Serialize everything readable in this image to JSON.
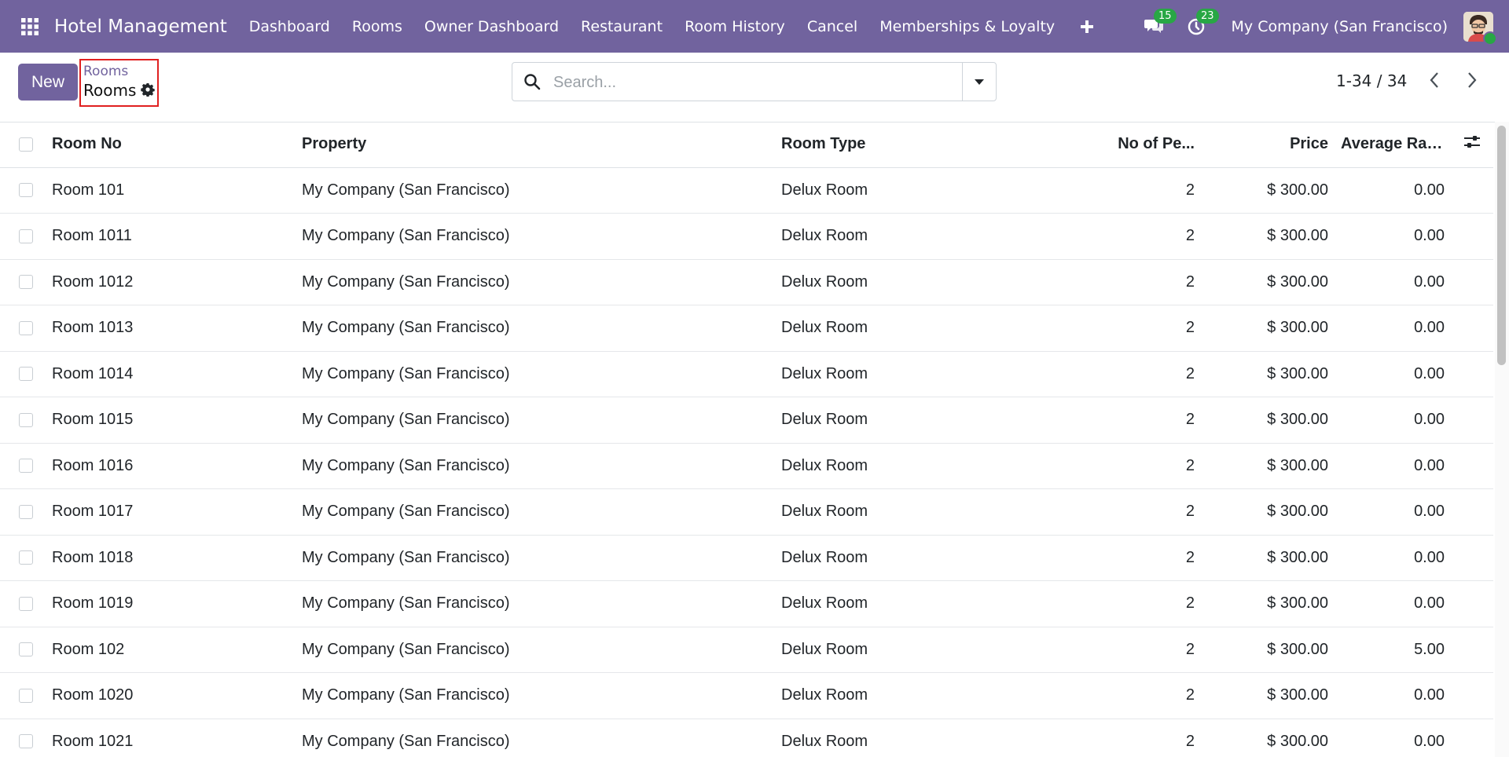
{
  "navbar": {
    "app_title": "Hotel Management",
    "menu": [
      "Dashboard",
      "Rooms",
      "Owner Dashboard",
      "Restaurant",
      "Room History",
      "Cancel",
      "Memberships & Loyalty"
    ],
    "messages_count": "15",
    "activities_count": "23",
    "company": "My Company (San Francisco)",
    "bg_color": "#71639e",
    "badge_color": "#28a745"
  },
  "control_panel": {
    "new_label": "New",
    "breadcrumb_parent": "Rooms",
    "breadcrumb_current": "Rooms",
    "search_placeholder": "Search...",
    "search_value": "",
    "pager": "1-34 / 34"
  },
  "table": {
    "headers": [
      "Room No",
      "Property",
      "Room Type",
      "No of Pe...",
      "Price",
      "Average Rat..."
    ],
    "rows": [
      {
        "room": "Room 101",
        "property": "My Company (San Francisco)",
        "type": "Delux Room",
        "persons": "2",
        "price": "$ 300.00",
        "rating": "0.00"
      },
      {
        "room": "Room 1011",
        "property": "My Company (San Francisco)",
        "type": "Delux Room",
        "persons": "2",
        "price": "$ 300.00",
        "rating": "0.00"
      },
      {
        "room": "Room 1012",
        "property": "My Company (San Francisco)",
        "type": "Delux Room",
        "persons": "2",
        "price": "$ 300.00",
        "rating": "0.00"
      },
      {
        "room": "Room 1013",
        "property": "My Company (San Francisco)",
        "type": "Delux Room",
        "persons": "2",
        "price": "$ 300.00",
        "rating": "0.00"
      },
      {
        "room": "Room 1014",
        "property": "My Company (San Francisco)",
        "type": "Delux Room",
        "persons": "2",
        "price": "$ 300.00",
        "rating": "0.00"
      },
      {
        "room": "Room 1015",
        "property": "My Company (San Francisco)",
        "type": "Delux Room",
        "persons": "2",
        "price": "$ 300.00",
        "rating": "0.00"
      },
      {
        "room": "Room 1016",
        "property": "My Company (San Francisco)",
        "type": "Delux Room",
        "persons": "2",
        "price": "$ 300.00",
        "rating": "0.00"
      },
      {
        "room": "Room 1017",
        "property": "My Company (San Francisco)",
        "type": "Delux Room",
        "persons": "2",
        "price": "$ 300.00",
        "rating": "0.00"
      },
      {
        "room": "Room 1018",
        "property": "My Company (San Francisco)",
        "type": "Delux Room",
        "persons": "2",
        "price": "$ 300.00",
        "rating": "0.00"
      },
      {
        "room": "Room 1019",
        "property": "My Company (San Francisco)",
        "type": "Delux Room",
        "persons": "2",
        "price": "$ 300.00",
        "rating": "0.00"
      },
      {
        "room": "Room 102",
        "property": "My Company (San Francisco)",
        "type": "Delux Room",
        "persons": "2",
        "price": "$ 300.00",
        "rating": "5.00"
      },
      {
        "room": "Room 1020",
        "property": "My Company (San Francisco)",
        "type": "Delux Room",
        "persons": "2",
        "price": "$ 300.00",
        "rating": "0.00"
      },
      {
        "room": "Room 1021",
        "property": "My Company (San Francisco)",
        "type": "Delux Room",
        "persons": "2",
        "price": "$ 300.00",
        "rating": "0.00"
      }
    ]
  }
}
